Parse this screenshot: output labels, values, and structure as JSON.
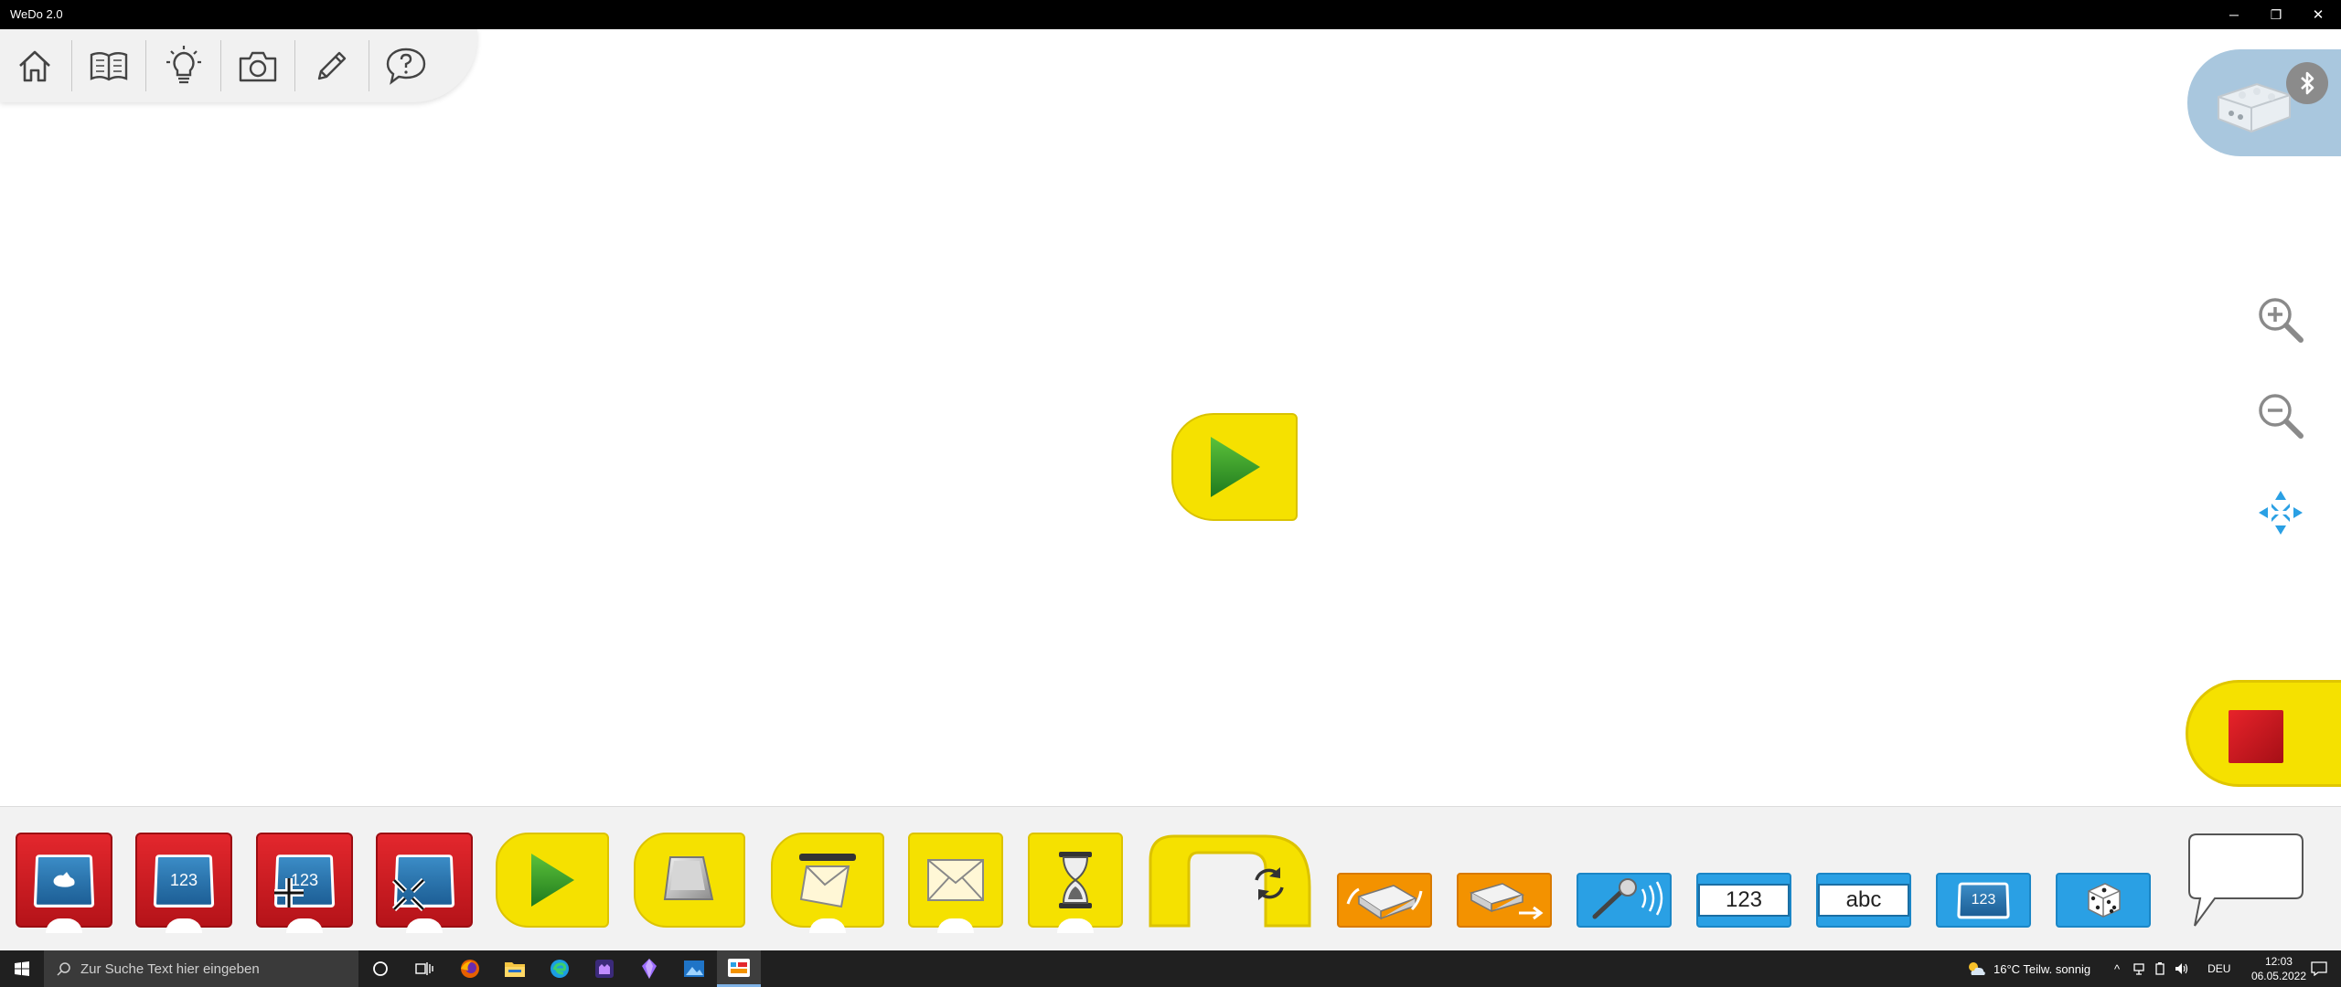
{
  "window": {
    "title": "WeDo 2.0",
    "minimize_label": "─",
    "restore_label": "❐",
    "close_label": "✕"
  },
  "toolbar": {
    "items": [
      "home",
      "book",
      "lightbulb",
      "camera",
      "pencil",
      "help"
    ]
  },
  "hub": {
    "name": "smarthub-icon",
    "bluetooth": "bluetooth-icon"
  },
  "canvas": {
    "start_block": "start-program-block"
  },
  "palette": {
    "blocks": [
      {
        "name": "display-background-block",
        "color": "red"
      },
      {
        "name": "display-number-block",
        "color": "red",
        "text": "123"
      },
      {
        "name": "add-to-display-block",
        "color": "red",
        "text": "123"
      },
      {
        "name": "display-fullscreen-block",
        "color": "red"
      },
      {
        "name": "start-block",
        "color": "yellow"
      },
      {
        "name": "start-on-key-block",
        "color": "yellow"
      },
      {
        "name": "start-on-message-block",
        "color": "yellow"
      },
      {
        "name": "send-message-block",
        "color": "yellow"
      },
      {
        "name": "wait-for-block",
        "color": "yellow"
      },
      {
        "name": "repeat-block",
        "color": "yellow"
      },
      {
        "name": "tilt-sensor-block",
        "color": "orange"
      },
      {
        "name": "motion-sensor-block",
        "color": "orange"
      },
      {
        "name": "sound-sensor-block",
        "color": "blue"
      },
      {
        "name": "number-input-block",
        "color": "blue",
        "text": "123"
      },
      {
        "name": "text-input-block",
        "color": "blue",
        "text": "abc"
      },
      {
        "name": "display-input-block",
        "color": "blue",
        "text": "123"
      },
      {
        "name": "random-input-block",
        "color": "blue"
      }
    ]
  },
  "taskbar": {
    "search_placeholder": "Zur Suche Text hier eingeben",
    "weather": "16°C  Teilw. sonnig",
    "language": "DEU",
    "time": "12:03",
    "date": "06.05.2022"
  },
  "colors": {
    "red": "#d81e24",
    "yellow": "#f5e100",
    "orange": "#f39200",
    "blue": "#2aa0e4",
    "hub": "#a9c7de"
  }
}
